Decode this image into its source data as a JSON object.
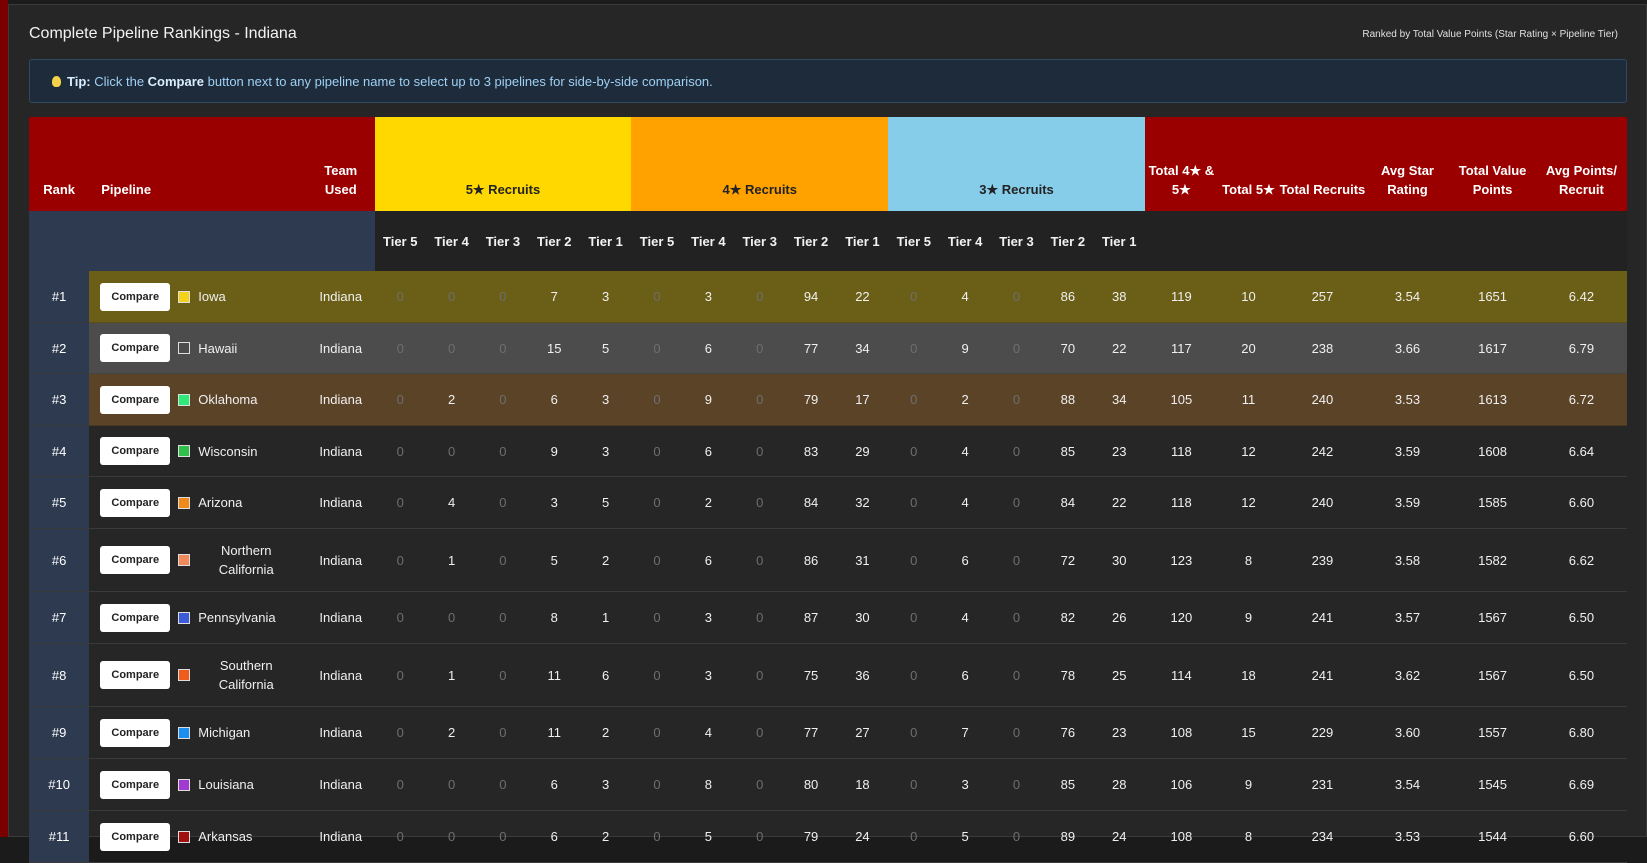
{
  "title": "Complete Pipeline Rankings - Indiana",
  "subtitle": "Ranked by Total Value Points (Star Rating × Pipeline Tier)",
  "tip": {
    "prefix": "Tip:",
    "text_before": " Click the ",
    "bold_word": "Compare",
    "text_after": " button next to any pipeline name to select up to 3 pipelines for side-by-side comparison."
  },
  "headers": {
    "rank": "Rank",
    "pipeline": "Pipeline",
    "team_used": "Team Used",
    "five_star": "5★ Recruits",
    "four_star": "4★ Recruits",
    "three_star": "3★ Recruits",
    "total_4_5": "Total 4★ & 5★",
    "total_5": "Total 5★",
    "total_recruits": "Total Recruits",
    "avg_star": "Avg Star Rating",
    "total_value": "Total Value Points",
    "avg_points": "Avg Points/ Recruit",
    "tiers": [
      "Tier 5",
      "Tier 4",
      "Tier 3",
      "Tier 2",
      "Tier 1"
    ]
  },
  "compare_label": "Compare",
  "rows": [
    {
      "rank": "#1",
      "pipeline": "Iowa",
      "swatch": "#f5d21a",
      "team": "Indiana",
      "s5": [
        0,
        0,
        0,
        7,
        3
      ],
      "s4": [
        0,
        3,
        0,
        94,
        22
      ],
      "s3": [
        0,
        4,
        0,
        86,
        38
      ],
      "total45": "119",
      "total5": "10",
      "total": "257",
      "avg_star": "3.54",
      "value": "1651",
      "avg_pts": "6.42"
    },
    {
      "rank": "#2",
      "pipeline": "Hawaii",
      "swatch": "#4c4c4c",
      "team": "Indiana",
      "s5": [
        0,
        0,
        0,
        15,
        5
      ],
      "s4": [
        0,
        6,
        0,
        77,
        34
      ],
      "s3": [
        0,
        9,
        0,
        70,
        22
      ],
      "total45": "117",
      "total5": "20",
      "total": "238",
      "avg_star": "3.66",
      "value": "1617",
      "avg_pts": "6.79"
    },
    {
      "rank": "#3",
      "pipeline": "Oklahoma",
      "swatch": "#2ee87a",
      "team": "Indiana",
      "s5": [
        0,
        2,
        0,
        6,
        3
      ],
      "s4": [
        0,
        9,
        0,
        79,
        17
      ],
      "s3": [
        0,
        2,
        0,
        88,
        34
      ],
      "total45": "105",
      "total5": "11",
      "total": "240",
      "avg_star": "3.53",
      "value": "1613",
      "avg_pts": "6.72"
    },
    {
      "rank": "#4",
      "pipeline": "Wisconsin",
      "swatch": "#2fbf4a",
      "team": "Indiana",
      "s5": [
        0,
        0,
        0,
        9,
        3
      ],
      "s4": [
        0,
        6,
        0,
        83,
        29
      ],
      "s3": [
        0,
        4,
        0,
        85,
        23
      ],
      "total45": "118",
      "total5": "12",
      "total": "242",
      "avg_star": "3.59",
      "value": "1608",
      "avg_pts": "6.64"
    },
    {
      "rank": "#5",
      "pipeline": "Arizona",
      "swatch": "#ef8a1a",
      "team": "Indiana",
      "s5": [
        0,
        4,
        0,
        3,
        5
      ],
      "s4": [
        0,
        2,
        0,
        84,
        32
      ],
      "s3": [
        0,
        4,
        0,
        84,
        22
      ],
      "total45": "118",
      "total5": "12",
      "total": "240",
      "avg_star": "3.59",
      "value": "1585",
      "avg_pts": "6.60"
    },
    {
      "rank": "#6",
      "pipeline": "Northern California",
      "swatch": "#f08a5a",
      "team": "Indiana",
      "s5": [
        0,
        1,
        0,
        5,
        2
      ],
      "s4": [
        0,
        6,
        0,
        86,
        31
      ],
      "s3": [
        0,
        6,
        0,
        72,
        30
      ],
      "total45": "123",
      "total5": "8",
      "total": "239",
      "avg_star": "3.58",
      "value": "1582",
      "avg_pts": "6.62"
    },
    {
      "rank": "#7",
      "pipeline": "Pennsylvania",
      "swatch": "#3b5bd9",
      "team": "Indiana",
      "s5": [
        0,
        0,
        0,
        8,
        1
      ],
      "s4": [
        0,
        3,
        0,
        87,
        30
      ],
      "s3": [
        0,
        4,
        0,
        82,
        26
      ],
      "total45": "120",
      "total5": "9",
      "total": "241",
      "avg_star": "3.57",
      "value": "1567",
      "avg_pts": "6.50"
    },
    {
      "rank": "#8",
      "pipeline": "Southern California",
      "swatch": "#f05a1a",
      "team": "Indiana",
      "s5": [
        0,
        1,
        0,
        11,
        6
      ],
      "s4": [
        0,
        3,
        0,
        75,
        36
      ],
      "s3": [
        0,
        6,
        0,
        78,
        25
      ],
      "total45": "114",
      "total5": "18",
      "total": "241",
      "avg_star": "3.62",
      "value": "1567",
      "avg_pts": "6.50"
    },
    {
      "rank": "#9",
      "pipeline": "Michigan",
      "swatch": "#1a8ff0",
      "team": "Indiana",
      "s5": [
        0,
        2,
        0,
        11,
        2
      ],
      "s4": [
        0,
        4,
        0,
        77,
        27
      ],
      "s3": [
        0,
        7,
        0,
        76,
        23
      ],
      "total45": "108",
      "total5": "15",
      "total": "229",
      "avg_star": "3.60",
      "value": "1557",
      "avg_pts": "6.80"
    },
    {
      "rank": "#10",
      "pipeline": "Louisiana",
      "swatch": "#a03ad0",
      "team": "Indiana",
      "s5": [
        0,
        0,
        0,
        6,
        3
      ],
      "s4": [
        0,
        8,
        0,
        80,
        18
      ],
      "s3": [
        0,
        3,
        0,
        85,
        28
      ],
      "total45": "106",
      "total5": "9",
      "total": "231",
      "avg_star": "3.54",
      "value": "1545",
      "avg_pts": "6.69"
    },
    {
      "rank": "#11",
      "pipeline": "Arkansas",
      "swatch": "#a01010",
      "team": "Indiana",
      "s5": [
        0,
        0,
        0,
        6,
        2
      ],
      "s4": [
        0,
        5,
        0,
        79,
        24
      ],
      "s3": [
        0,
        5,
        0,
        89,
        24
      ],
      "total45": "108",
      "total5": "8",
      "total": "234",
      "avg_star": "3.53",
      "value": "1544",
      "avg_pts": "6.60"
    }
  ]
}
